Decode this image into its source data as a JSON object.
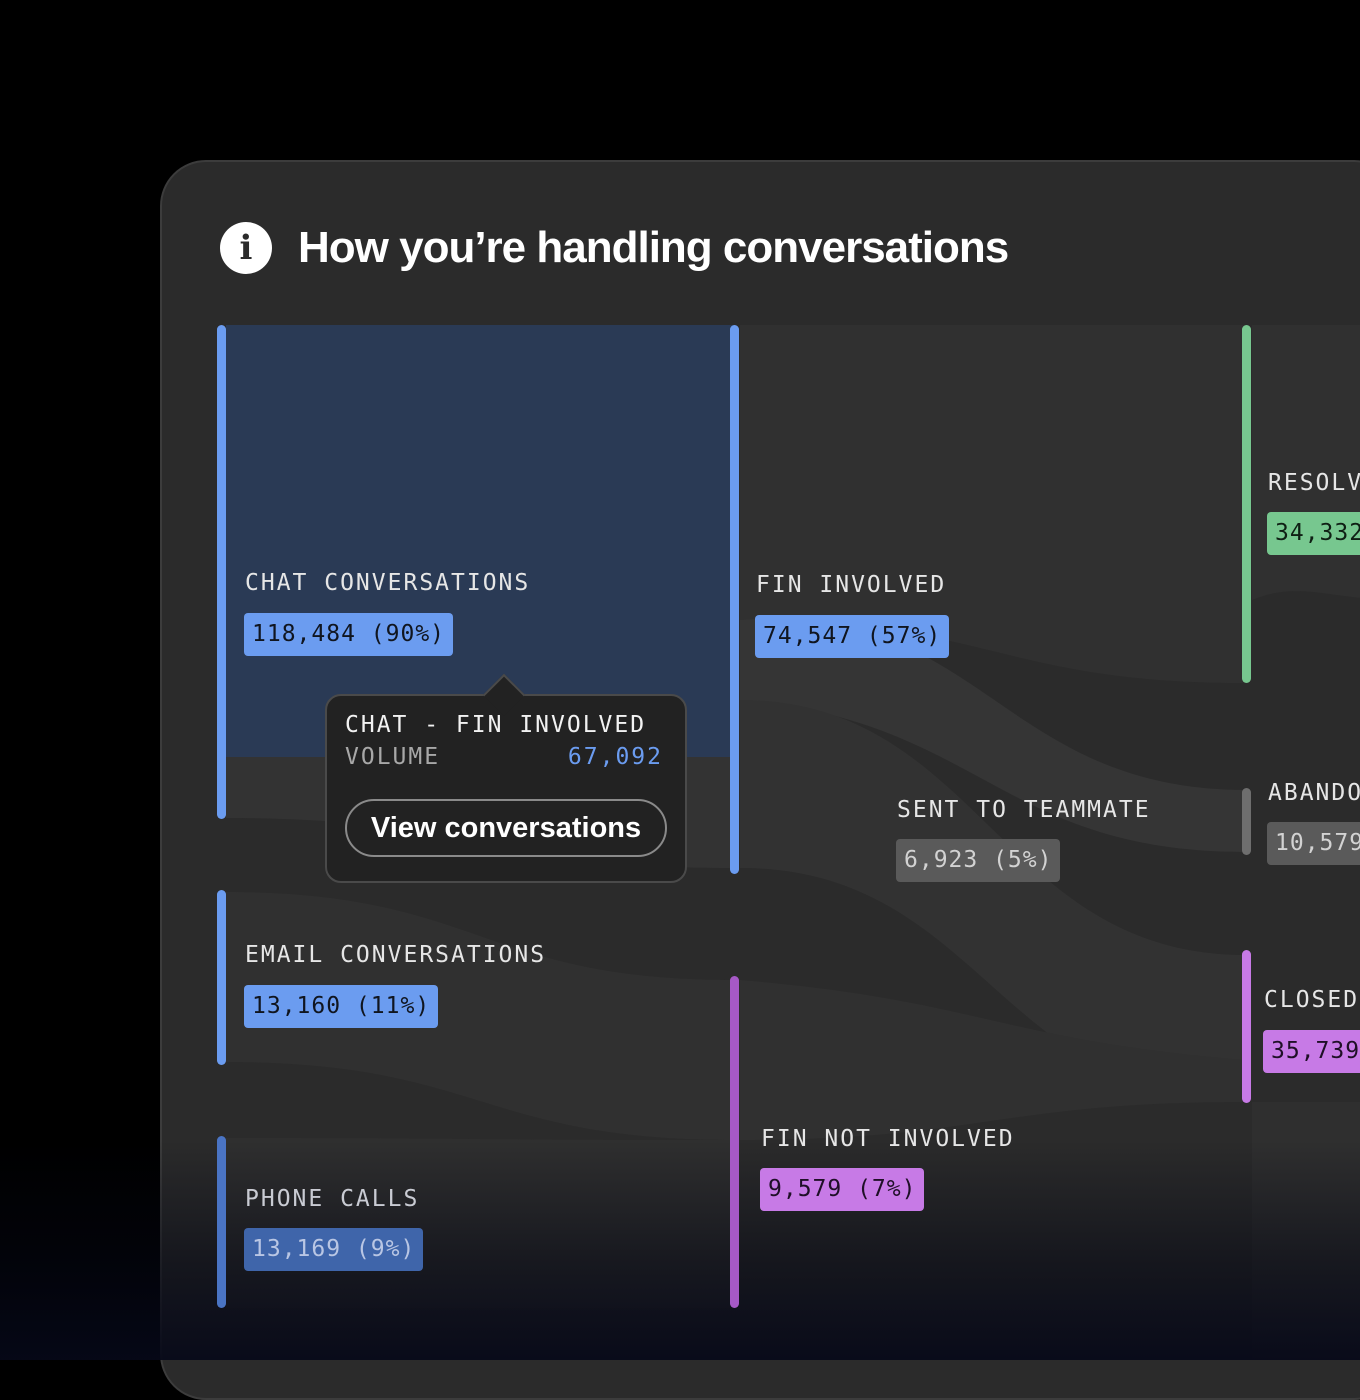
{
  "header": {
    "info_icon": "info-icon",
    "title": "How you’re handling conversations"
  },
  "colors": {
    "blue": "#6b9cf0",
    "green": "#77c78f",
    "gray": "#5a5a5a",
    "purple": "#c77ae6",
    "panel": "#2b2b2b",
    "highlight": "#2a3a55"
  },
  "sources": {
    "chat": {
      "label": "CHAT CONVERSATIONS",
      "value": "118,484 (90%)"
    },
    "email": {
      "label": "EMAIL CONVERSATIONS",
      "value": "13,160 (11%)"
    },
    "phone": {
      "label": "PHONE CALLS",
      "value": "13,169 (9%)"
    }
  },
  "middle": {
    "fin_involved": {
      "label": "FIN INVOLVED",
      "value": "74,547 (57%)"
    },
    "sent_to_teammate": {
      "label": "SENT TO TEAMMATE",
      "value": "6,923 (5%)"
    },
    "fin_not_involved": {
      "label": "FIN NOT INVOLVED",
      "value": "9,579 (7%)"
    }
  },
  "outcomes": {
    "resolved": {
      "label": "RESOLVE",
      "value": "34,332"
    },
    "abandoned": {
      "label": "ABANDON",
      "value": "10,579"
    },
    "closed": {
      "label": "CLOSED",
      "value": "35,739"
    }
  },
  "tooltip": {
    "title": "CHAT - FIN INVOLVED",
    "volume_label": "VOLUME",
    "volume_value": "67,092",
    "button_label": "View conversations"
  }
}
